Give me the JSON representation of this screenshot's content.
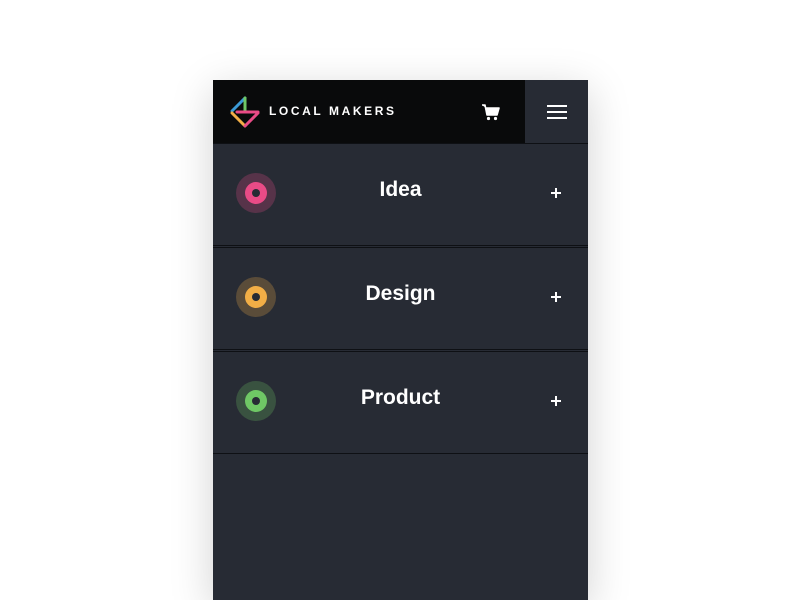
{
  "header": {
    "brand": "LOCAL MAKERS",
    "logo_icon": "logo-diamond-icon",
    "cart_icon": "cart-icon",
    "menu_icon": "hamburger-menu-icon"
  },
  "items": [
    {
      "label": "Idea",
      "icon": "target-dot-icon",
      "color": "#e94b86",
      "expand_icon": "plus-icon"
    },
    {
      "label": "Design",
      "icon": "target-dot-icon",
      "color": "#f2ae46",
      "expand_icon": "plus-icon"
    },
    {
      "label": "Product",
      "icon": "target-dot-icon",
      "color": "#6fc865",
      "expand_icon": "plus-icon"
    }
  ],
  "colors": {
    "header_bg": "#090a0b",
    "panel_bg": "#272b34",
    "text": "#ffffff"
  }
}
